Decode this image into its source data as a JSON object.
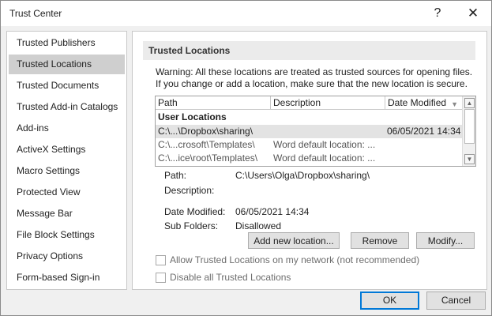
{
  "window": {
    "title": "Trust Center",
    "help_glyph": "?",
    "close_glyph": "✕"
  },
  "sidebar": {
    "items": [
      {
        "label": "Trusted Publishers",
        "selected": false
      },
      {
        "label": "Trusted Locations",
        "selected": true
      },
      {
        "label": "Trusted Documents",
        "selected": false
      },
      {
        "label": "Trusted Add-in Catalogs",
        "selected": false
      },
      {
        "label": "Add-ins",
        "selected": false
      },
      {
        "label": "ActiveX Settings",
        "selected": false
      },
      {
        "label": "Macro Settings",
        "selected": false
      },
      {
        "label": "Protected View",
        "selected": false
      },
      {
        "label": "Message Bar",
        "selected": false
      },
      {
        "label": "File Block Settings",
        "selected": false
      },
      {
        "label": "Privacy Options",
        "selected": false
      },
      {
        "label": "Form-based Sign-in",
        "selected": false
      }
    ]
  },
  "main": {
    "section_title": "Trusted Locations",
    "warning_line1": "Warning: All these locations are treated as trusted sources for opening files.",
    "warning_line2": "If you change or add a location, make sure that the new location is secure.",
    "table": {
      "columns": [
        "Path",
        "Description",
        "Date Modified"
      ],
      "group_label": "User Locations",
      "rows": [
        {
          "path": "C:\\...\\Dropbox\\sharing\\",
          "description": "",
          "date": "06/05/2021 14:34",
          "selected": true
        },
        {
          "path": "C:\\...crosoft\\Templates\\",
          "description": "Word default location: ...",
          "date": "",
          "selected": false
        },
        {
          "path": "C:\\...ice\\root\\Templates\\",
          "description": "Word default location: ...",
          "date": "",
          "selected": false
        }
      ]
    },
    "details": {
      "path_label": "Path:",
      "path_value": "C:\\Users\\Olga\\Dropbox\\sharing\\",
      "description_label": "Description:",
      "description_value": "",
      "date_label": "Date Modified:",
      "date_value": "06/05/2021 14:34",
      "subfolders_label": "Sub Folders:",
      "subfolders_value": "Disallowed"
    },
    "buttons": {
      "add": "Add new location...",
      "remove": "Remove",
      "modify": "Modify..."
    },
    "checkboxes": {
      "allow_network": {
        "label": "Allow Trusted Locations on my network (not recommended)",
        "checked": false,
        "enabled": false
      },
      "disable_all": {
        "label": "Disable all Trusted Locations",
        "checked": false,
        "enabled": false
      }
    }
  },
  "footer": {
    "ok": "OK",
    "cancel": "Cancel"
  }
}
